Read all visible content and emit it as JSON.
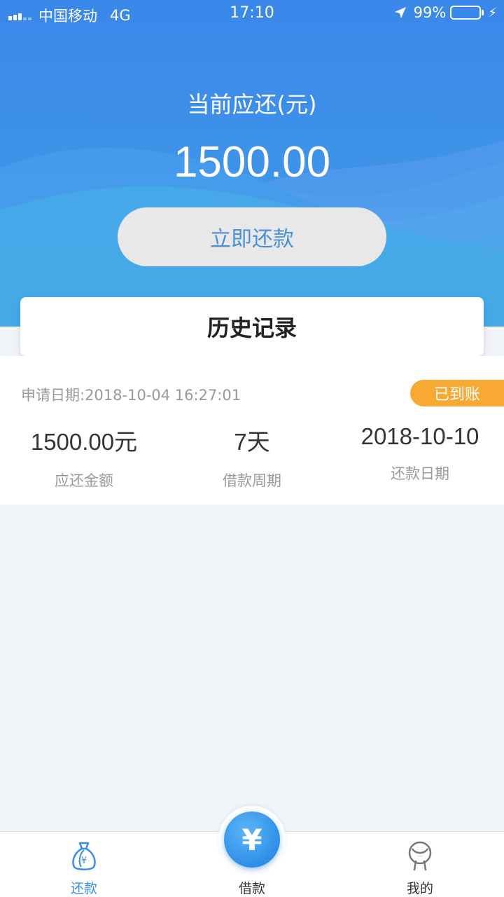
{
  "status_bar": {
    "carrier": "中国移动",
    "network": "4G",
    "time": "17:10",
    "battery": "99%"
  },
  "header": {
    "due_label": "当前应还(元)",
    "due_amount": "1500.00",
    "repay_button": "立即还款"
  },
  "history": {
    "title": "历史记录"
  },
  "record": {
    "apply_date": "申请日期:2018-10-04 16:27:01",
    "status": "已到账",
    "amount_value": "1500.00元",
    "amount_label": "应还金额",
    "period_value": "7天",
    "period_label": "借款周期",
    "repay_date_value": "2018-10-10",
    "repay_date_label": "还款日期"
  },
  "tabbar": {
    "repay": "还款",
    "loan": "借款",
    "loan_symbol": "¥",
    "mine": "我的"
  },
  "colors": {
    "brand_blue": "#3a87ea",
    "badge_orange": "#f7a934"
  }
}
